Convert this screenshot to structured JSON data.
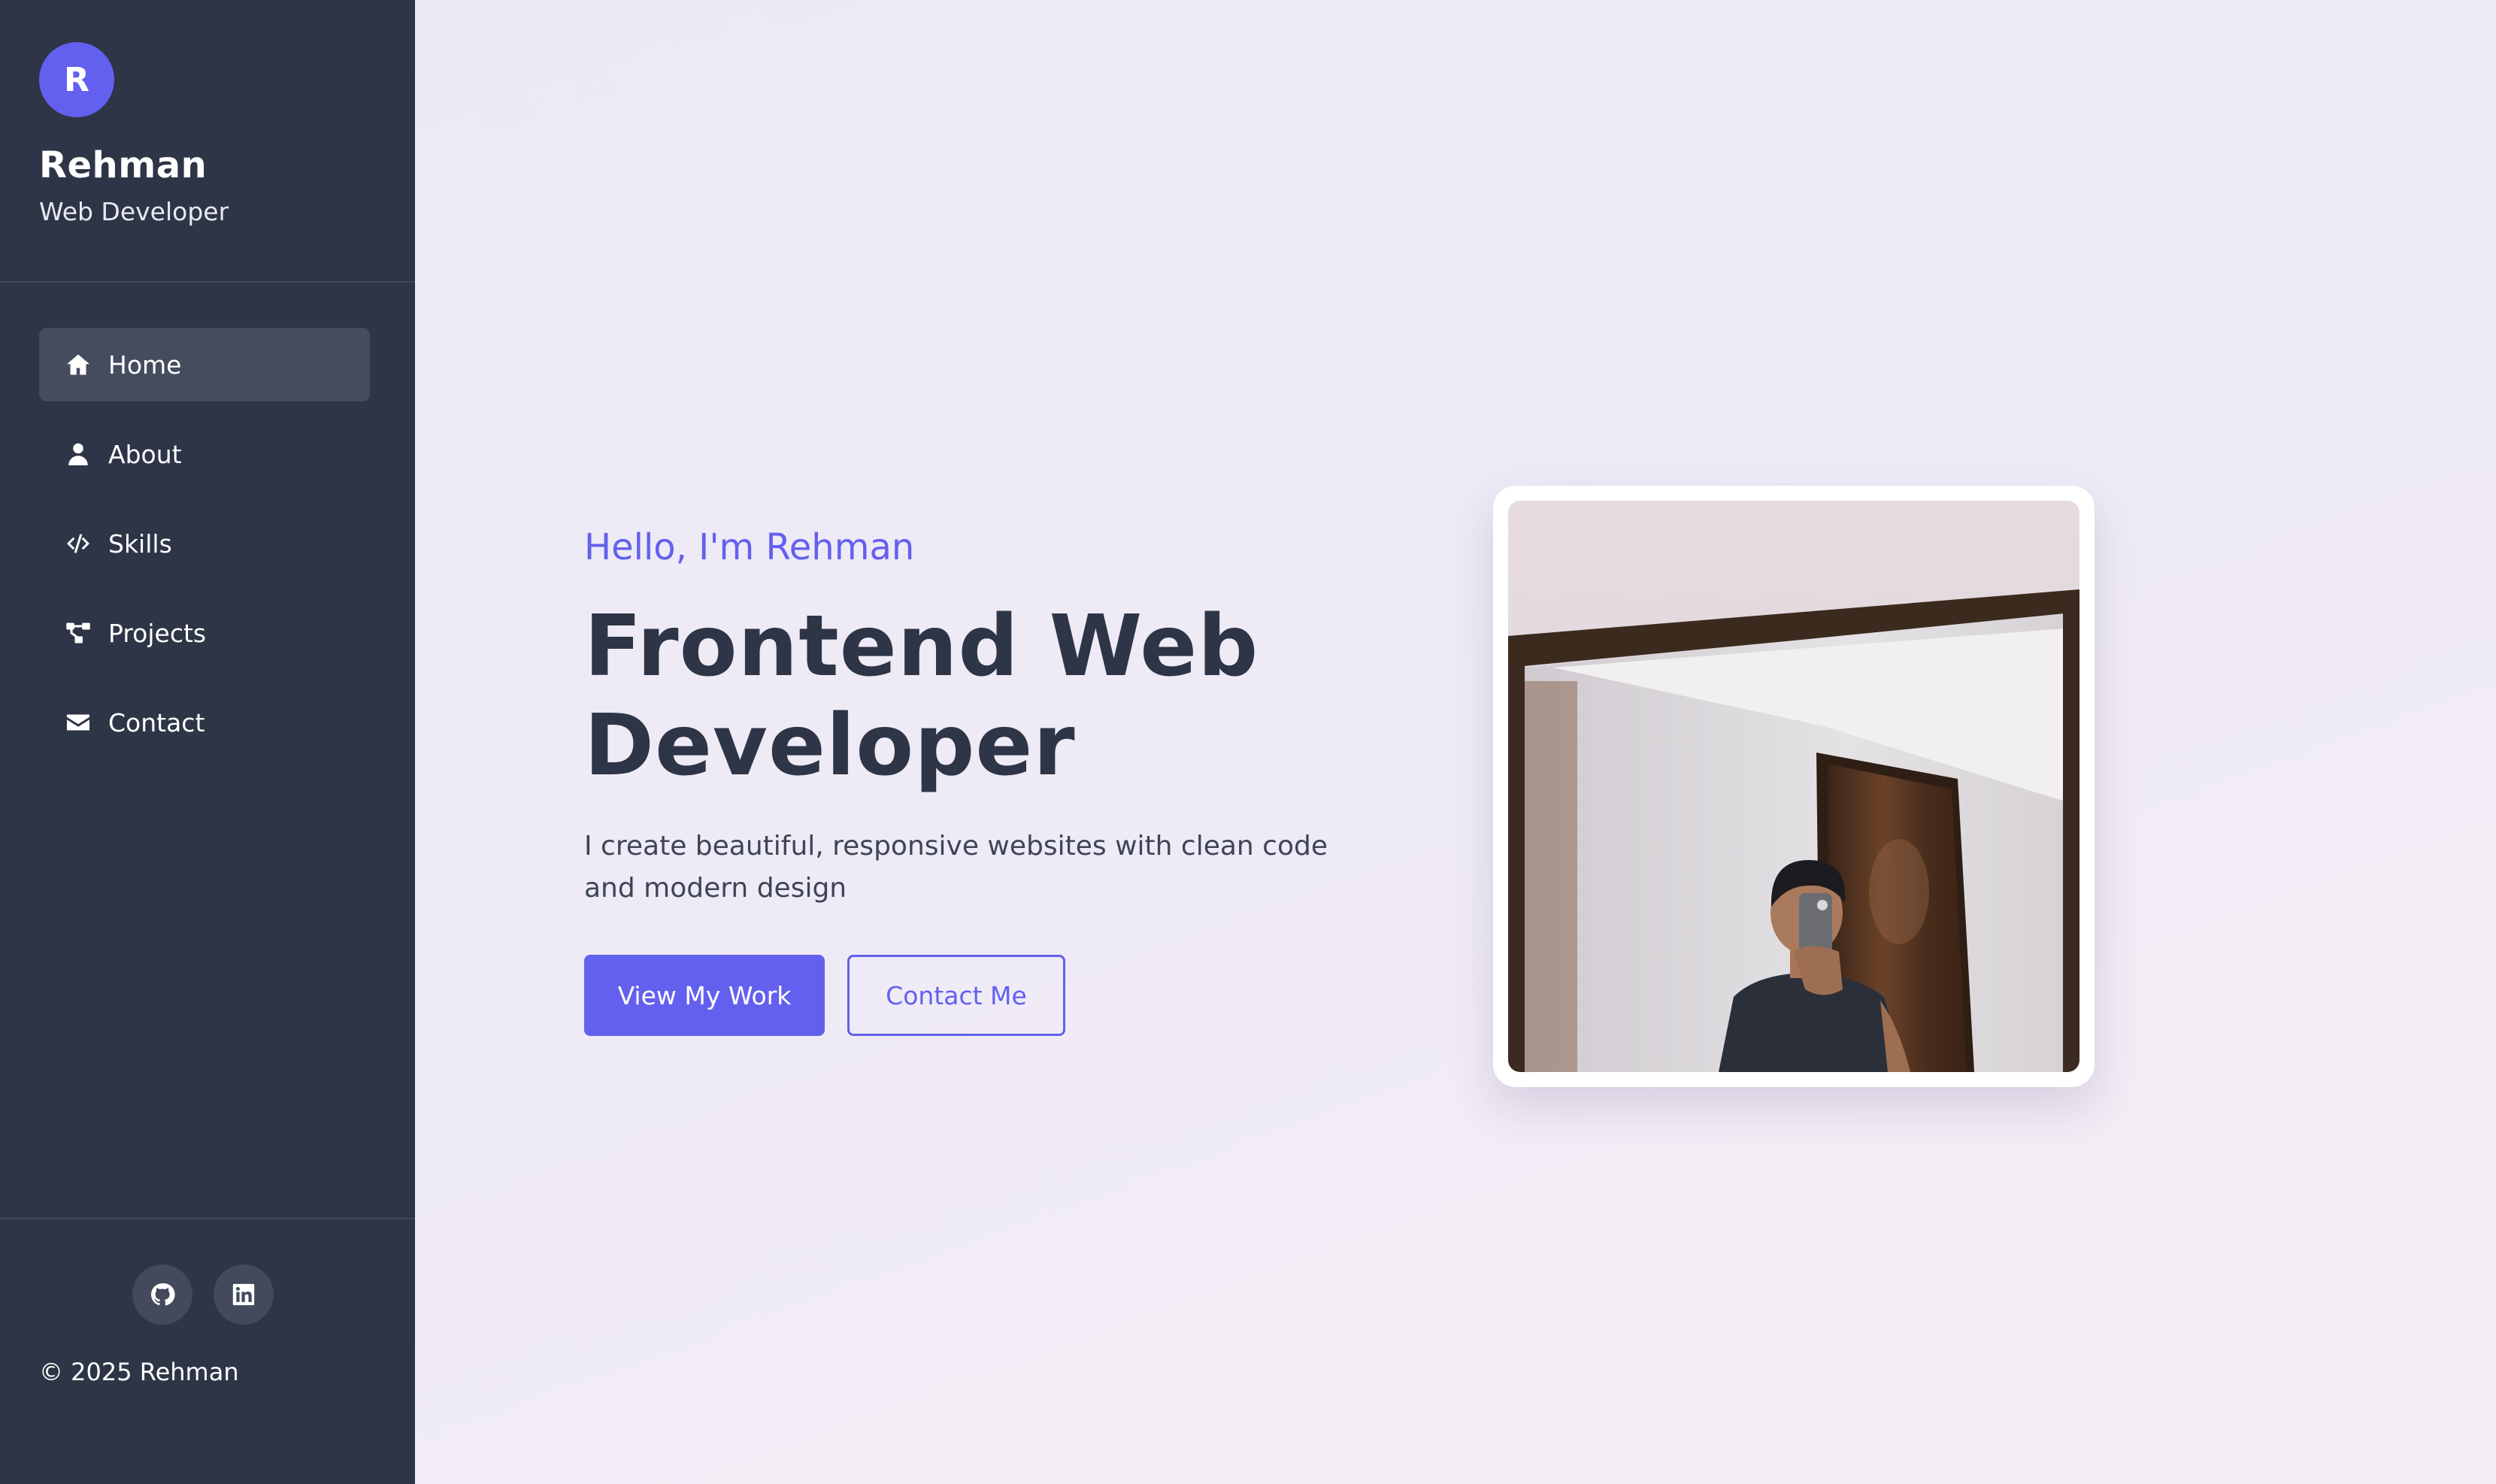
{
  "sidebar": {
    "avatar_letter": "R",
    "name": "Rehman",
    "role": "Web Developer",
    "items": [
      {
        "label": "Home",
        "icon": "home-icon",
        "active": true
      },
      {
        "label": "About",
        "icon": "user-icon",
        "active": false
      },
      {
        "label": "Skills",
        "icon": "code-icon",
        "active": false
      },
      {
        "label": "Projects",
        "icon": "project-diagram-icon",
        "active": false
      },
      {
        "label": "Contact",
        "icon": "envelope-icon",
        "active": false
      }
    ],
    "social": [
      {
        "icon": "github-icon"
      },
      {
        "icon": "linkedin-icon"
      }
    ],
    "copyright": "© 2025 Rehman"
  },
  "hero": {
    "greeting": "Hello, I'm Rehman",
    "headline_line1": "Frontend Web",
    "headline_line2": "Developer",
    "tagline": "I create beautiful, responsive websites with clean code and modern design",
    "primary_button": "View My Work",
    "secondary_button": "Contact Me"
  },
  "colors": {
    "accent": "#6360ef",
    "sidebar_bg": "#2d3546",
    "text_dark": "#2d3546"
  }
}
